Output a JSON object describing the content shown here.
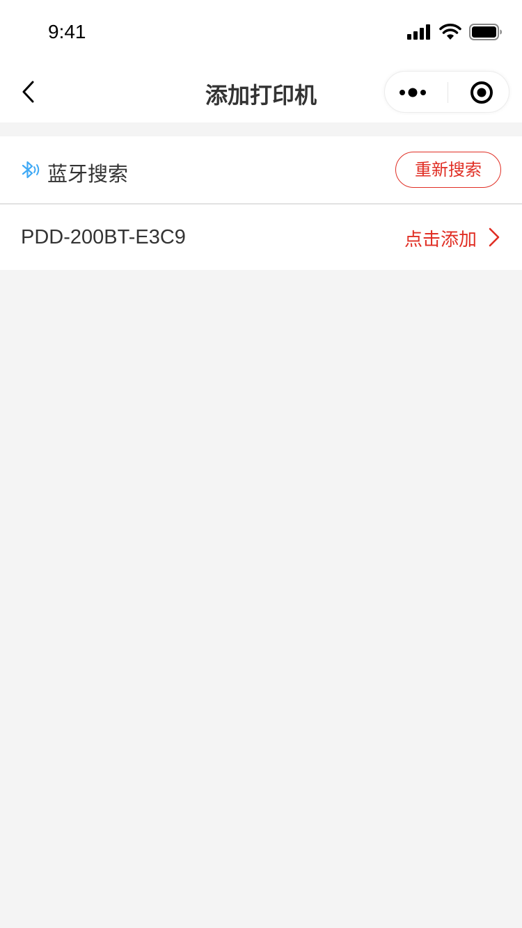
{
  "status_bar": {
    "time": "9:41",
    "icons": [
      "signal-icon",
      "wifi-icon",
      "battery-icon"
    ]
  },
  "nav": {
    "title": "添加打印机",
    "back_icon": "back-arrow-icon",
    "capsule_icons": [
      "more-dots-icon",
      "close-target-icon"
    ]
  },
  "bluetooth": {
    "icon": "bluetooth-icon",
    "title": "蓝牙搜索",
    "research_label": "重新搜索"
  },
  "devices": [
    {
      "name": "PDD-200BT-E3C9",
      "action_label": "点击添加",
      "action_icon": "chevron-right-icon"
    }
  ],
  "colors": {
    "accent_red": "#e02e24",
    "bluetooth_blue": "#3fa9f5",
    "background": "#f4f4f4",
    "text": "#333333"
  }
}
